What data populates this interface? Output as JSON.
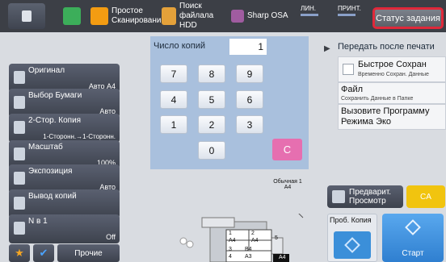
{
  "topbar": {
    "quick_scan": "Простое Сканирование",
    "hdd_search": "Поиск файлала HDD",
    "osa": "Sharp OSA",
    "line": "ЛИН.",
    "print": "ПРИНТ.",
    "job_status": "Статус задания"
  },
  "left": {
    "items": [
      {
        "name": "Оригинал",
        "value": "Авто  A4"
      },
      {
        "name": "Выбор Бумаги",
        "value": "Авто"
      },
      {
        "name": "2-Стор. Копия",
        "value": "1-Сторонн.→1-Сторонн."
      },
      {
        "name": "Масштаб",
        "value": "100%"
      },
      {
        "name": "Экспозиция",
        "value": "Авто"
      },
      {
        "name": "Вывод копий",
        "value": ""
      },
      {
        "name": "N в 1",
        "value": "Off"
      }
    ],
    "other": "Прочие"
  },
  "copies": {
    "label": "Число копий",
    "value": "1"
  },
  "keypad": {
    "keys": [
      "7",
      "8",
      "9",
      "4",
      "5",
      "6",
      "1",
      "2",
      "3",
      "0"
    ],
    "clear": "C"
  },
  "right": {
    "header": "Передать после печати",
    "quick_save": "Быстрое Сохран",
    "quick_save_sub": "Временно Сохран. Данные",
    "file": "Файл",
    "file_sub": "Сохранить Данные в Папке",
    "eco": "Вызовите Программу Режима Эко"
  },
  "machine": {
    "output_label": "Обычная 1",
    "output_size": "A4",
    "trays": [
      "1",
      "2",
      "3",
      "4",
      "5"
    ],
    "tray_sizes": [
      "A4",
      "A4",
      "B4",
      "A3",
      "A4"
    ]
  },
  "actions": {
    "preview": "Предварит. Просмотр",
    "ca": "CA",
    "proof": "Проб. Копия",
    "start": "Старт"
  },
  "colors": {
    "accent_red": "#e0283a",
    "start_blue": "#3b8fd9",
    "ca_yellow": "#f1c40f",
    "clear_pink": "#e66fb0"
  }
}
